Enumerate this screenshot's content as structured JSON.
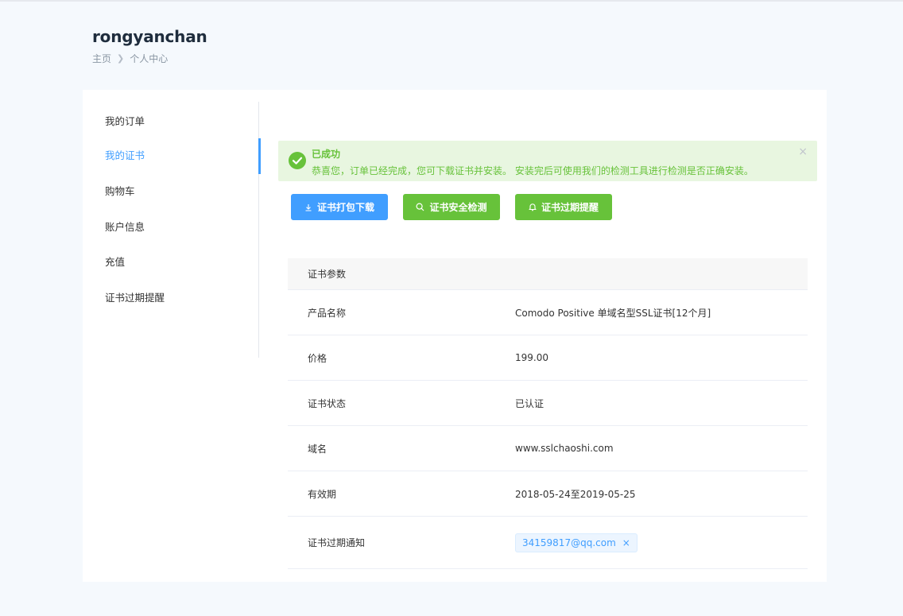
{
  "header": {
    "title": "rongyanchan",
    "breadcrumb": [
      "主页",
      "个人中心"
    ]
  },
  "sidebar": {
    "items": [
      {
        "label": "我的订单",
        "active": false
      },
      {
        "label": "我的证书",
        "active": true
      },
      {
        "label": "购物车",
        "active": false
      },
      {
        "label": "账户信息",
        "active": false
      },
      {
        "label": "充值",
        "active": false
      },
      {
        "label": "证书过期提醒",
        "active": false
      }
    ]
  },
  "alert": {
    "title": "已成功",
    "description": "恭喜您，订单已经完成，您可下载证书并安装。 安装完后可使用我们的检测工具进行检测是否正确安装。",
    "close": "×"
  },
  "actions": {
    "download": "证书打包下载",
    "check": "证书安全检测",
    "reminder": "证书过期提醒"
  },
  "table": {
    "header": "证书参数",
    "rows": [
      {
        "key": "产品名称",
        "value": "Comodo Positive 单域名型SSL证书[12个月]"
      },
      {
        "key": "价格",
        "value": "199.00"
      },
      {
        "key": "证书状态",
        "value": "已认证"
      },
      {
        "key": "域名",
        "value": "www.sslchaoshi.com"
      },
      {
        "key": "有效期",
        "value": "2018-05-24至2019-05-25"
      },
      {
        "key": "证书过期通知",
        "tag": "34159817@qq.com",
        "tag_close": "×"
      }
    ]
  },
  "colors": {
    "primary": "#409eff",
    "success": "#67c23a",
    "alert_bg": "#e8f6e0"
  }
}
